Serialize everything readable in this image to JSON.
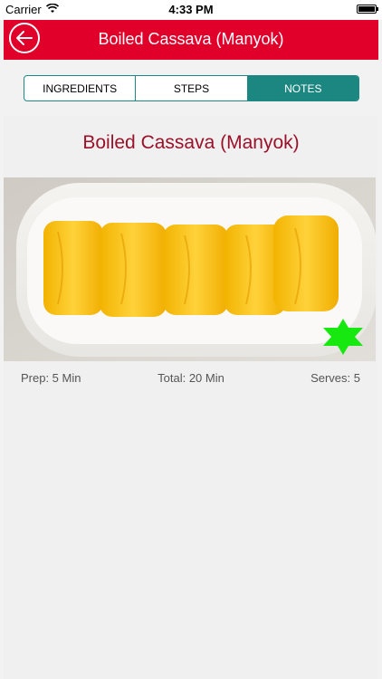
{
  "status_bar": {
    "carrier": "Carrier",
    "time": "4:33 PM"
  },
  "nav": {
    "title": "Boiled Cassava (Manyok)",
    "back_icon": "back-arrow-icon"
  },
  "tabs": [
    {
      "label": "INGREDIENTS",
      "active": false
    },
    {
      "label": "STEPS",
      "active": false
    },
    {
      "label": "NOTES",
      "active": true
    }
  ],
  "recipe": {
    "title": "Boiled Cassava (Manyok)",
    "prep": "Prep: 5 Min",
    "total": "Total: 20 Min",
    "serves": "Serves: 5",
    "favorite_icon": "star-icon"
  },
  "colors": {
    "nav_red": "#e0002a",
    "tab_teal": "#1c8680",
    "title_red": "#9b1129",
    "star_green": "#17e80f"
  }
}
